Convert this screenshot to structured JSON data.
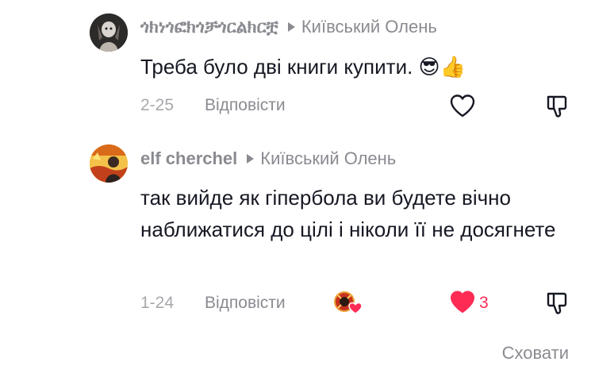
{
  "comments": [
    {
      "username": "ጎክነጎፎክጎቻጎርልክርቿ",
      "reply_to": "Київський Олень",
      "text": "Треба було дві книги купити. 😎👍",
      "date": "2-25",
      "reply_label": "Відповісти",
      "liked": false
    },
    {
      "username": "elf cherchel",
      "reply_to": "Київський Олень",
      "text": "так вийде як гіпербола ви будете вічно наближатися до цілі і ніколи її не досягнете",
      "date": "1-24",
      "reply_label": "Відповісти",
      "liked": true,
      "like_count": "3"
    }
  ],
  "hide_label": "Сховати",
  "colors": {
    "like_active": "#fe2c55",
    "muted": "#8a8b91",
    "text": "#161823"
  }
}
